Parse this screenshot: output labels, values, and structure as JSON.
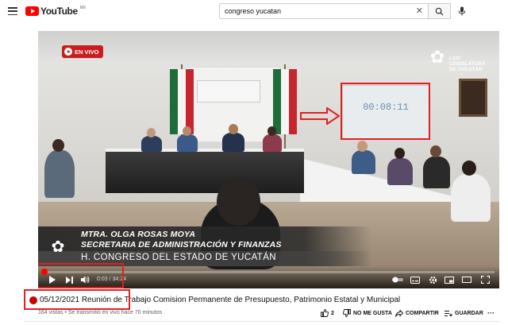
{
  "header": {
    "logo_text": "YouTube",
    "logo_cc": "MX",
    "search_value": "congreso yucatan"
  },
  "video": {
    "live_badge": "EN VIVO",
    "overlay_timer": "00:08:11",
    "logo_lines": [
      "LXIII",
      "LEGISLATURA",
      "DE YUCATÁN"
    ],
    "banner": {
      "name": "MTRA. OLGA ROSAS MOYA",
      "role": "SECRETARIA DE ADMINISTRACIÓN Y FINANZAS",
      "institution": "H. CONGRESO DEL ESTADO DE YUCATÁN"
    },
    "time_display": "0:03 / 34:24",
    "progress_fraction": 0.0015,
    "annotation_color": "#e02020"
  },
  "info": {
    "title": "05/12/2021 Reunión de Trabajo Comision Permanente de Presupuesto, Patrimonio Estatal y Municipal",
    "meta": "164 vistas • Se transmitió en vivo hace 70 minutos",
    "like_count": "2",
    "dislike_label": "NO ME GUSTA",
    "share_label": "COMPARTIR",
    "save_label": "GUARDAR",
    "more_label": "···"
  }
}
